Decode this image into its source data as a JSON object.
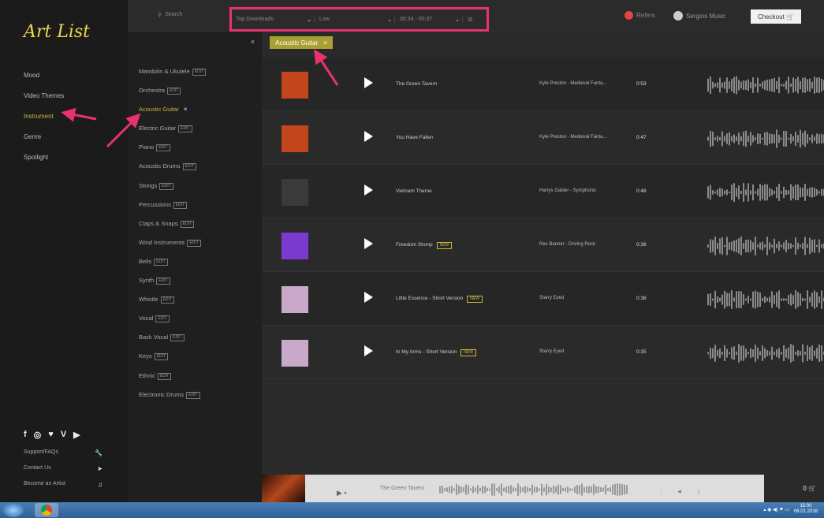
{
  "logo": "Art List",
  "nav": {
    "items": [
      "Mood",
      "Video Themes",
      "Instrument",
      "Genre",
      "Spotlight"
    ],
    "active_index": 2
  },
  "socials": [
    "f",
    "◎",
    "♥",
    "V",
    "▶"
  ],
  "footer": {
    "links": [
      {
        "label": "Support/FAQs",
        "icon": "wrench-icon"
      },
      {
        "label": "Contact Us",
        "icon": "send-icon"
      },
      {
        "label": "Become an Artist",
        "icon": "music-note-icon"
      }
    ]
  },
  "instrument_panel": {
    "close": "×",
    "items": [
      {
        "label": "Mandolin & Ukulele",
        "badge": "EDIT"
      },
      {
        "label": "Orchestra",
        "badge": "EDIT"
      },
      {
        "label": "Acoustic Guitar",
        "badge": "",
        "active": true
      },
      {
        "label": "Electric Guitar",
        "badge": "EDIT"
      },
      {
        "label": "Piano",
        "badge": "EDIT"
      },
      {
        "label": "Acoustic Drums",
        "badge": "EDIT"
      },
      {
        "label": "Strings",
        "badge": "EDIT"
      },
      {
        "label": "Percussions",
        "badge": "EDIT"
      },
      {
        "label": "Claps & Snaps",
        "badge": "EDIT"
      },
      {
        "label": "Wind Instruments",
        "badge": "EDIT"
      },
      {
        "label": "Bells",
        "badge": "EDIT"
      },
      {
        "label": "Synth",
        "badge": "EDIT"
      },
      {
        "label": "Whistle",
        "badge": "EDIT"
      },
      {
        "label": "Vocal",
        "badge": "EDIT"
      },
      {
        "label": "Back Vocal",
        "badge": "EDIT"
      },
      {
        "label": "Keys",
        "badge": "EDIT"
      },
      {
        "label": "Ethnic",
        "badge": "EDIT"
      },
      {
        "label": "Electronic Drums",
        "badge": "EDIT"
      }
    ]
  },
  "topbar": {
    "search_placeholder": "Search",
    "sort": "Top Downloads",
    "level": "Low",
    "duration": "00:34 - 00:37",
    "refers": "Refers",
    "user": "Sergios Music",
    "checkout": "Checkout"
  },
  "active_tag": "Acoustic Guitar",
  "tracks": [
    {
      "title": "The Green Tavern",
      "new": false,
      "artist": "Kyle Preston - Medieval Fanta...",
      "duration": "0:53",
      "cover_color": "#c2451c"
    },
    {
      "title": "You Have Fallen",
      "new": false,
      "artist": "Kyle Preston - Medieval Fanta...",
      "duration": "0:47",
      "cover_color": "#c2451c"
    },
    {
      "title": "Vietnam Theme",
      "new": false,
      "artist": "Harrys Gabler - Symphonic",
      "duration": "0:48",
      "cover_color": "#3a3a3a"
    },
    {
      "title": "Freedom Stomp",
      "new": true,
      "artist": "Rex Banner - Driving Rock",
      "duration": "0:36",
      "cover_color": "#7a3ad0"
    },
    {
      "title": "Little Essence - Short Version",
      "new": true,
      "artist": "Starry Eyed",
      "duration": "0:38",
      "cover_color": "#c9a9c9"
    },
    {
      "title": "In My Arms - Short Version",
      "new": true,
      "artist": "Starry Eyed",
      "duration": "0:35",
      "cover_color": "#c9a9c9"
    }
  ],
  "new_badge": "NEW",
  "player": {
    "title": "The Green Tavern",
    "cart_count": "0"
  },
  "taskbar": {
    "time": "15:00",
    "date": "06.01.2016"
  },
  "colors": {
    "accent": "#c8b73a",
    "highlight": "#e8326e",
    "tag_bg": "#a8a032"
  }
}
